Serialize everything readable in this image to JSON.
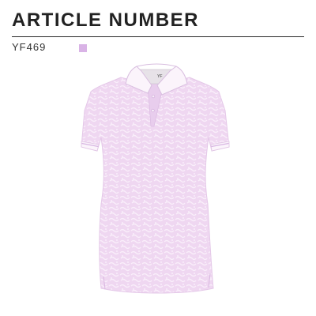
{
  "header": {
    "title": "ARTICLE NUMBER"
  },
  "product": {
    "code": "YF469",
    "collar_tag": "YF",
    "swatch_color": "#d9b3e6",
    "shirt_color": "#efd7f1",
    "pattern_color": "#f9eefa",
    "trim_color": "#fbf4fb",
    "stripe_color": "#d7b5e2",
    "inner_collar_color": "#e7e2e8",
    "icon": "polo-shirt-icon"
  }
}
